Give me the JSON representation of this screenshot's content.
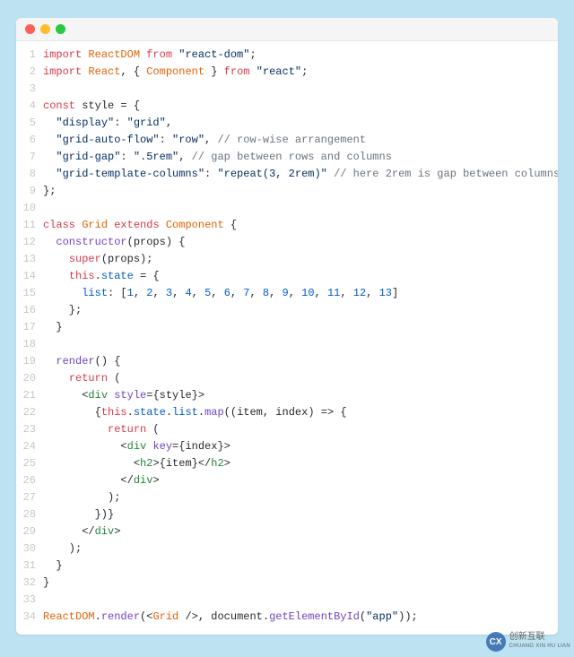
{
  "window": {
    "traffic_colors": {
      "close": "#ff5f56",
      "min": "#ffbd2e",
      "max": "#27c93f"
    }
  },
  "code": {
    "line_count": 34,
    "lines": [
      [
        [
          "kw",
          "import"
        ],
        [
          "pn",
          " "
        ],
        [
          "cls",
          "ReactDOM"
        ],
        [
          "pn",
          " "
        ],
        [
          "kw",
          "from"
        ],
        [
          "pn",
          " "
        ],
        [
          "str",
          "\"react-dom\""
        ],
        [
          "pn",
          ";"
        ]
      ],
      [
        [
          "kw",
          "import"
        ],
        [
          "pn",
          " "
        ],
        [
          "cls",
          "React"
        ],
        [
          "pn",
          ", { "
        ],
        [
          "cls",
          "Component"
        ],
        [
          "pn",
          " } "
        ],
        [
          "kw",
          "from"
        ],
        [
          "pn",
          " "
        ],
        [
          "str",
          "\"react\""
        ],
        [
          "pn",
          ";"
        ]
      ],
      [],
      [
        [
          "kw",
          "const"
        ],
        [
          "pn",
          " "
        ],
        [
          "var",
          "style"
        ],
        [
          "pn",
          " = {"
        ]
      ],
      [
        [
          "pn",
          "  "
        ],
        [
          "str",
          "\"display\""
        ],
        [
          "pn",
          ": "
        ],
        [
          "str",
          "\"grid\""
        ],
        [
          "pn",
          ","
        ]
      ],
      [
        [
          "pn",
          "  "
        ],
        [
          "str",
          "\"grid-auto-flow\""
        ],
        [
          "pn",
          ": "
        ],
        [
          "str",
          "\"row\""
        ],
        [
          "pn",
          ", "
        ],
        [
          "cmt",
          "// row-wise arrangement"
        ]
      ],
      [
        [
          "pn",
          "  "
        ],
        [
          "str",
          "\"grid-gap\""
        ],
        [
          "pn",
          ": "
        ],
        [
          "str",
          "\".5rem\""
        ],
        [
          "pn",
          ", "
        ],
        [
          "cmt",
          "// gap between rows and columns"
        ]
      ],
      [
        [
          "pn",
          "  "
        ],
        [
          "str",
          "\"grid-template-columns\""
        ],
        [
          "pn",
          ": "
        ],
        [
          "str",
          "\"repeat(3, 2rem)\""
        ],
        [
          "pn",
          " "
        ],
        [
          "cmt",
          "// here 2rem is gap between columns"
        ]
      ],
      [
        [
          "pn",
          "};"
        ]
      ],
      [],
      [
        [
          "kw",
          "class"
        ],
        [
          "pn",
          " "
        ],
        [
          "cls",
          "Grid"
        ],
        [
          "pn",
          " "
        ],
        [
          "kw",
          "extends"
        ],
        [
          "pn",
          " "
        ],
        [
          "cls",
          "Component"
        ],
        [
          "pn",
          " {"
        ]
      ],
      [
        [
          "pn",
          "  "
        ],
        [
          "def",
          "constructor"
        ],
        [
          "pn",
          "("
        ],
        [
          "var",
          "props"
        ],
        [
          "pn",
          ") {"
        ]
      ],
      [
        [
          "pn",
          "    "
        ],
        [
          "kw",
          "super"
        ],
        [
          "pn",
          "("
        ],
        [
          "var",
          "props"
        ],
        [
          "pn",
          ");"
        ]
      ],
      [
        [
          "pn",
          "    "
        ],
        [
          "kw",
          "this"
        ],
        [
          "pn",
          "."
        ],
        [
          "prop",
          "state"
        ],
        [
          "pn",
          " = {"
        ]
      ],
      [
        [
          "pn",
          "      "
        ],
        [
          "prop",
          "list"
        ],
        [
          "pn",
          ": ["
        ],
        [
          "num",
          "1"
        ],
        [
          "pn",
          ", "
        ],
        [
          "num",
          "2"
        ],
        [
          "pn",
          ", "
        ],
        [
          "num",
          "3"
        ],
        [
          "pn",
          ", "
        ],
        [
          "num",
          "4"
        ],
        [
          "pn",
          ", "
        ],
        [
          "num",
          "5"
        ],
        [
          "pn",
          ", "
        ],
        [
          "num",
          "6"
        ],
        [
          "pn",
          ", "
        ],
        [
          "num",
          "7"
        ],
        [
          "pn",
          ", "
        ],
        [
          "num",
          "8"
        ],
        [
          "pn",
          ", "
        ],
        [
          "num",
          "9"
        ],
        [
          "pn",
          ", "
        ],
        [
          "num",
          "10"
        ],
        [
          "pn",
          ", "
        ],
        [
          "num",
          "11"
        ],
        [
          "pn",
          ", "
        ],
        [
          "num",
          "12"
        ],
        [
          "pn",
          ", "
        ],
        [
          "num",
          "13"
        ],
        [
          "pn",
          "]"
        ]
      ],
      [
        [
          "pn",
          "    };"
        ]
      ],
      [
        [
          "pn",
          "  }"
        ]
      ],
      [],
      [
        [
          "pn",
          "  "
        ],
        [
          "def",
          "render"
        ],
        [
          "pn",
          "() {"
        ]
      ],
      [
        [
          "pn",
          "    "
        ],
        [
          "kw",
          "return"
        ],
        [
          "pn",
          " ("
        ]
      ],
      [
        [
          "pn",
          "      <"
        ],
        [
          "tag",
          "div"
        ],
        [
          "pn",
          " "
        ],
        [
          "attr",
          "style"
        ],
        [
          "pn",
          "={"
        ],
        [
          "var",
          "style"
        ],
        [
          "pn",
          "}>"
        ]
      ],
      [
        [
          "pn",
          "        {"
        ],
        [
          "kw",
          "this"
        ],
        [
          "pn",
          "."
        ],
        [
          "prop",
          "state"
        ],
        [
          "pn",
          "."
        ],
        [
          "prop",
          "list"
        ],
        [
          "pn",
          "."
        ],
        [
          "def",
          "map"
        ],
        [
          "pn",
          "(("
        ],
        [
          "var",
          "item"
        ],
        [
          "pn",
          ", "
        ],
        [
          "var",
          "index"
        ],
        [
          "pn",
          ") => {"
        ]
      ],
      [
        [
          "pn",
          "          "
        ],
        [
          "kw",
          "return"
        ],
        [
          "pn",
          " ("
        ]
      ],
      [
        [
          "pn",
          "            <"
        ],
        [
          "tag",
          "div"
        ],
        [
          "pn",
          " "
        ],
        [
          "attr",
          "key"
        ],
        [
          "pn",
          "={"
        ],
        [
          "var",
          "index"
        ],
        [
          "pn",
          "}>"
        ]
      ],
      [
        [
          "pn",
          "              <"
        ],
        [
          "tag",
          "h2"
        ],
        [
          "pn",
          ">{"
        ],
        [
          "var",
          "item"
        ],
        [
          "pn",
          "}</"
        ],
        [
          "tag",
          "h2"
        ],
        [
          "pn",
          ">"
        ]
      ],
      [
        [
          "pn",
          "            </"
        ],
        [
          "tag",
          "div"
        ],
        [
          "pn",
          ">"
        ]
      ],
      [
        [
          "pn",
          "          );"
        ]
      ],
      [
        [
          "pn",
          "        })}"
        ]
      ],
      [
        [
          "pn",
          "      </"
        ],
        [
          "tag",
          "div"
        ],
        [
          "pn",
          ">"
        ]
      ],
      [
        [
          "pn",
          "    );"
        ]
      ],
      [
        [
          "pn",
          "  }"
        ]
      ],
      [
        [
          "pn",
          "}"
        ]
      ],
      [],
      [
        [
          "cls",
          "ReactDOM"
        ],
        [
          "pn",
          "."
        ],
        [
          "def",
          "render"
        ],
        [
          "pn",
          "(<"
        ],
        [
          "cls",
          "Grid"
        ],
        [
          "pn",
          " />, "
        ],
        [
          "var",
          "document"
        ],
        [
          "pn",
          "."
        ],
        [
          "def",
          "getElementById"
        ],
        [
          "pn",
          "("
        ],
        [
          "str",
          "\"app\""
        ],
        [
          "pn",
          "));"
        ]
      ]
    ]
  },
  "watermark": {
    "icon_text": "CX",
    "line1": "创新互联",
    "line2": "CHUANG XIN HU LIAN"
  }
}
